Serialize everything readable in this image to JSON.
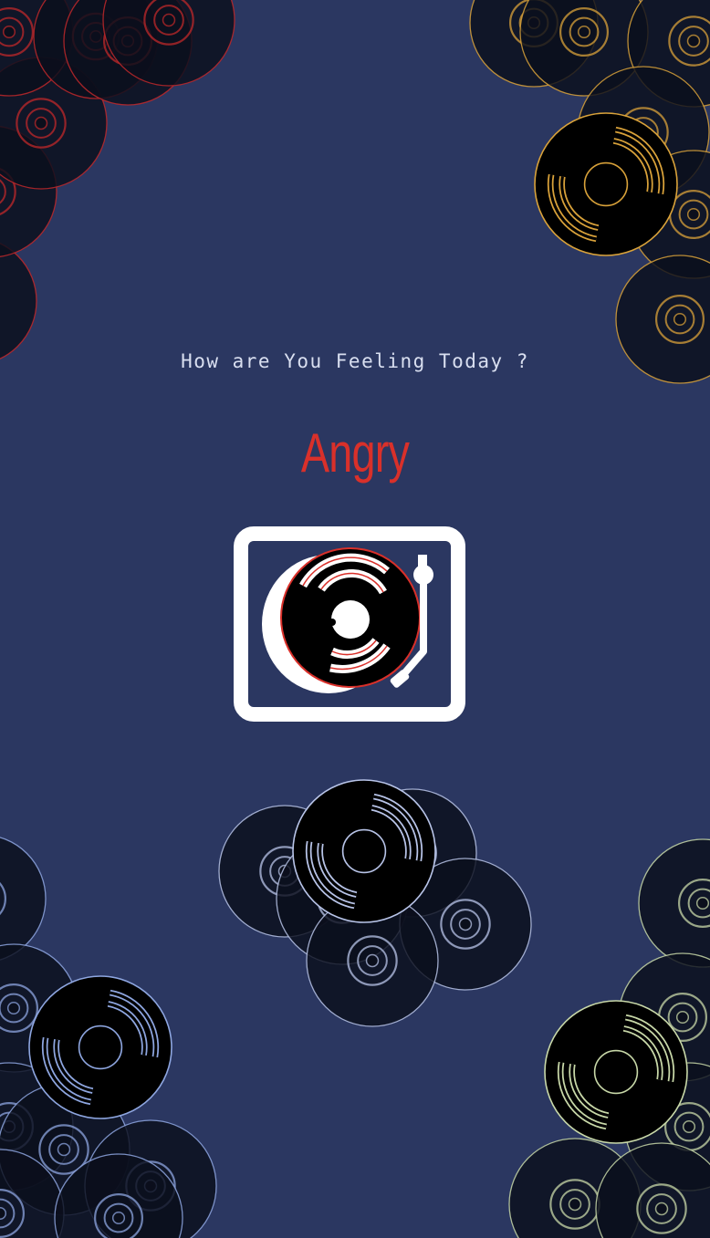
{
  "prompt": {
    "question": "How are You Feeling Today ?"
  },
  "mood": {
    "label": "Angry",
    "color": "#d9302a"
  },
  "turntable": {
    "icon": "turntable-icon",
    "record_accent": "#d9302a"
  },
  "decor": {
    "record_icon": "vinyl-record-icon",
    "clusters": [
      {
        "name": "top-left-records",
        "color": "#c0282a"
      },
      {
        "name": "top-right-records",
        "color": "#d9a23a"
      },
      {
        "name": "center-records",
        "color": "#b8c4e8"
      },
      {
        "name": "bottom-left-records",
        "color": "#8ea6e0"
      },
      {
        "name": "bottom-right-records",
        "color": "#c8d8a8"
      }
    ]
  }
}
